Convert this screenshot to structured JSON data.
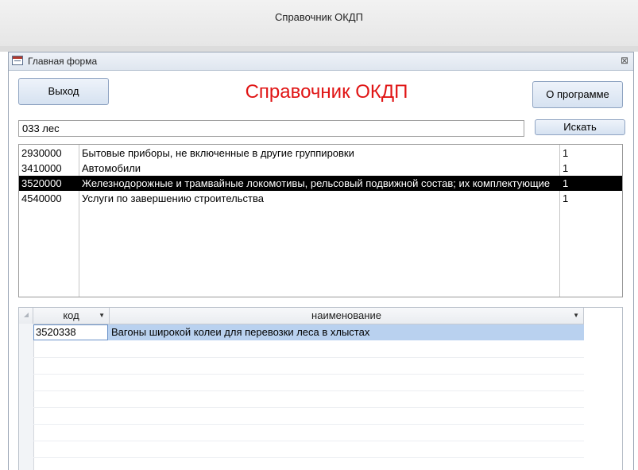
{
  "window": {
    "title": "Справочник ОКДП"
  },
  "form": {
    "title": "Главная форма",
    "close_glyph": "⊠"
  },
  "header": {
    "exit_label": "Выход",
    "app_title": "Справочник ОКДП",
    "about_label": "О программе",
    "title_color": "#e01515"
  },
  "search": {
    "value": "033 лес",
    "button_label": "Искать"
  },
  "list": {
    "rows": [
      {
        "code": "2930000",
        "name": "Бытовые приборы, не включенные в другие группировки",
        "flag": "1",
        "selected": false
      },
      {
        "code": "3410000",
        "name": "Автомобили",
        "flag": "1",
        "selected": false
      },
      {
        "code": "3520000",
        "name": "Железнодорожные и трамвайные локомотивы, рельсовый подвижной состав; их комплектующие",
        "flag": "1",
        "selected": true
      },
      {
        "code": "4540000",
        "name": "Услуги по завершению строительства",
        "flag": "1",
        "selected": false
      }
    ]
  },
  "grid": {
    "columns": [
      {
        "label": "код",
        "arrow": "▼"
      },
      {
        "label": "наименование",
        "arrow": "▼"
      }
    ],
    "rows": [
      {
        "code": "3520338",
        "name": "Вагоны широкой колеи для перевозки леса в хлыстах"
      }
    ]
  }
}
